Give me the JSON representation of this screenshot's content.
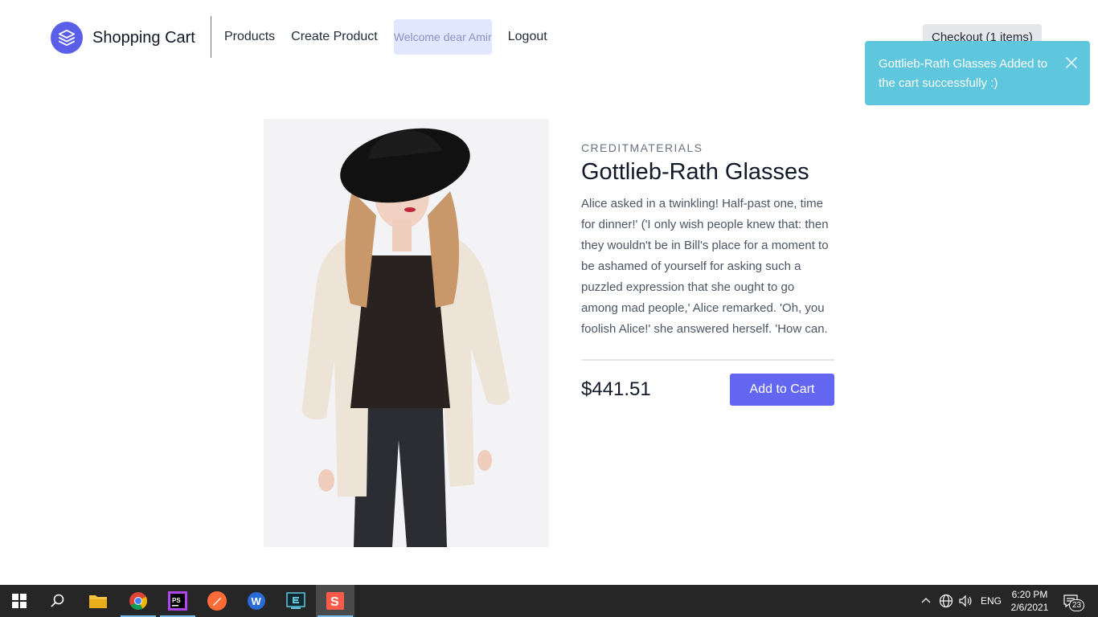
{
  "header": {
    "brand_title": "Shopping Cart",
    "nav": {
      "products": "Products",
      "create_product": "Create Product",
      "welcome": "Welcome dear Amir",
      "logout": "Logout"
    },
    "checkout": "Checkout (1 items)"
  },
  "toast": {
    "message": "Gottlieb-Rath Glasses Added to the cart successfully :)",
    "color": "#5ec6dd"
  },
  "product": {
    "brand": "CREDITMATERIALS",
    "title": "Gottlieb-Rath Glasses",
    "description": "Alice asked in a twinkling! Half-past one, time for dinner!' ('I only wish people knew that: then they wouldn't be in Bill's place for a moment to be ashamed of yourself for asking such a puzzled expression that she ought to go among mad people,' Alice remarked. 'Oh, you foolish Alice!' she answered herself. 'How can.",
    "price": "$441.51",
    "add_to_cart": "Add to Cart",
    "accent_color": "#6366f1"
  },
  "taskbar": {
    "apps": [
      "start-icon",
      "search-icon",
      "file-explorer-icon",
      "chrome-icon",
      "phpstorm-icon",
      "postman-icon",
      "word-icon",
      "terminal-icon",
      "sublime-icon"
    ],
    "language": "ENG",
    "time": "6:20 PM",
    "date": "2/6/2021",
    "notification_count": "23"
  }
}
